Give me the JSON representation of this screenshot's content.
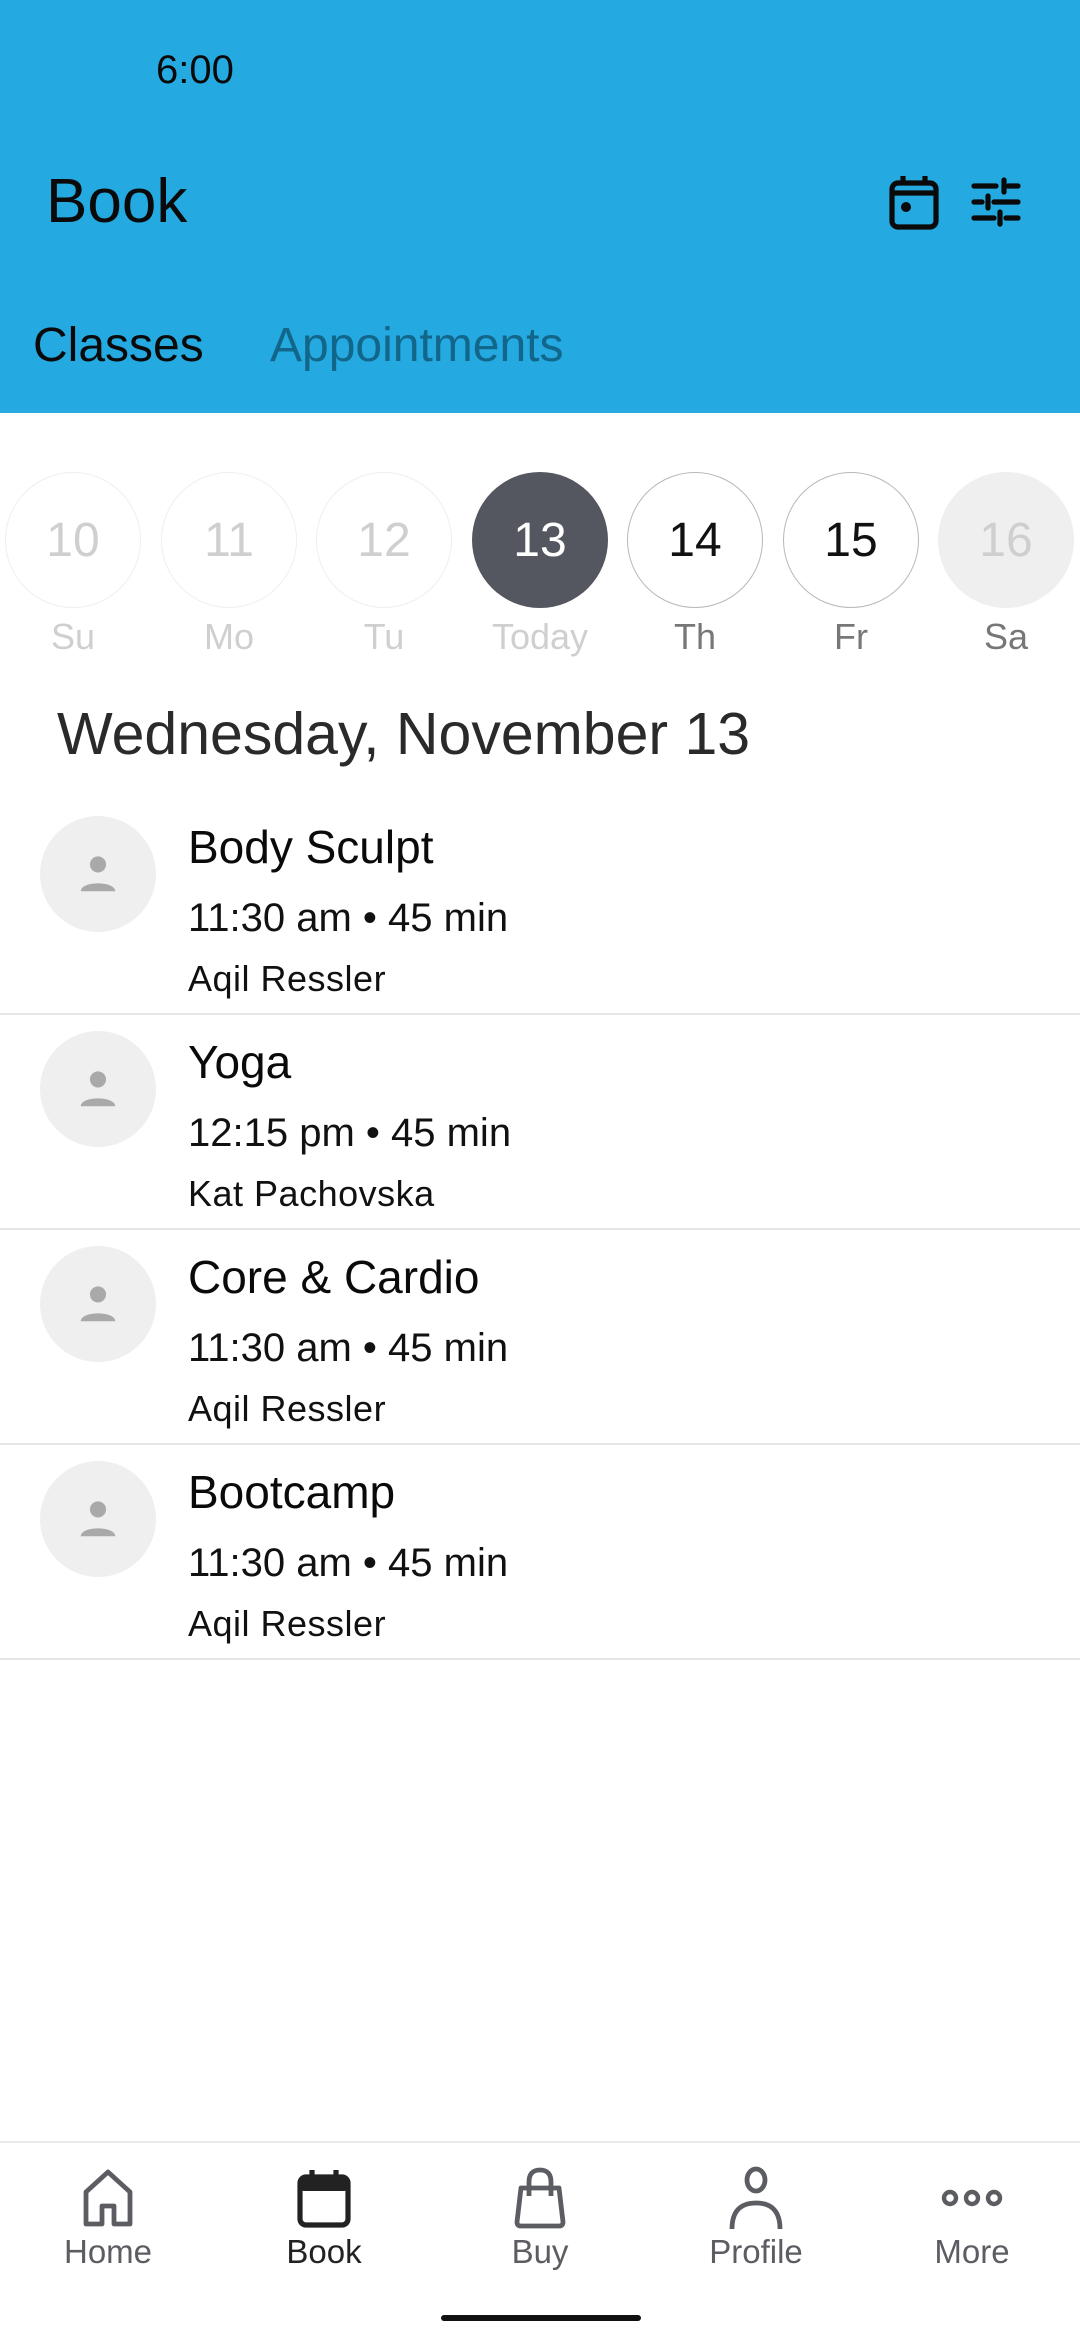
{
  "status_bar": {
    "time": "6:00"
  },
  "header": {
    "title": "Book",
    "actions": [
      {
        "icon": "calendar-icon",
        "label": "Calendar"
      },
      {
        "icon": "filter-sliders-icon",
        "label": "Filters"
      }
    ]
  },
  "tabs": [
    {
      "label": "Classes",
      "selected": true
    },
    {
      "label": "Appointments",
      "selected": false
    }
  ],
  "date_strip": [
    {
      "day": "10",
      "weekday": "Su",
      "state": "past"
    },
    {
      "day": "11",
      "weekday": "Mo",
      "state": "past"
    },
    {
      "day": "12",
      "weekday": "Tu",
      "state": "past"
    },
    {
      "day": "13",
      "weekday": "Today",
      "state": "selected"
    },
    {
      "day": "14",
      "weekday": "Th",
      "state": "available"
    },
    {
      "day": "15",
      "weekday": "Fr",
      "state": "available"
    },
    {
      "day": "16",
      "weekday": "Sa",
      "state": "unavailable"
    }
  ],
  "date_heading": "Wednesday, November 13",
  "classes": [
    {
      "name": "Body Sculpt",
      "time_duration": "11:30 am • 45 min",
      "instructor": "Aqil Ressler"
    },
    {
      "name": "Yoga",
      "time_duration": "12:15 pm • 45 min",
      "instructor": "Kat Pachovska"
    },
    {
      "name": "Core & Cardio",
      "time_duration": "11:30 am • 45 min",
      "instructor": "Aqil Ressler"
    },
    {
      "name": "Bootcamp",
      "time_duration": "11:30 am • 45 min",
      "instructor": "Aqil Ressler"
    }
  ],
  "bottom_nav": [
    {
      "label": "Home",
      "icon": "home-icon",
      "active": false
    },
    {
      "label": "Book",
      "icon": "calendar-icon",
      "active": true
    },
    {
      "label": "Buy",
      "icon": "shopping-bag-icon",
      "active": false
    },
    {
      "label": "Profile",
      "icon": "person-icon",
      "active": false
    },
    {
      "label": "More",
      "icon": "more-horizontal-icon",
      "active": false
    }
  ],
  "colors": {
    "header_bg": "#24a9e1",
    "tab_inactive": "#12668a",
    "selected_date_bg": "#54575f",
    "avatar_bg": "#efefef",
    "avatar_glyph": "#a9a9a9"
  }
}
